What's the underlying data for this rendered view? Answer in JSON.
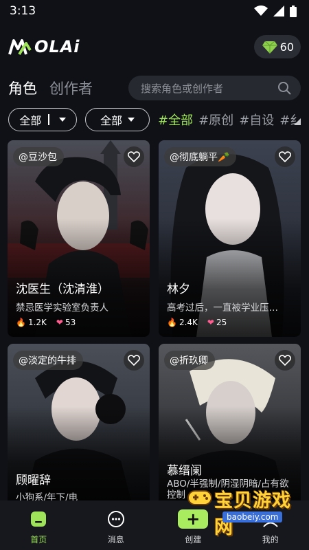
{
  "status_bar": {
    "time": "3:13"
  },
  "header": {
    "logo_text": "OLAi",
    "gem_count": "60"
  },
  "tabs": [
    {
      "label": "角色"
    },
    {
      "label": "创作者"
    }
  ],
  "search": {
    "placeholder": "搜索角色或创作者"
  },
  "filters": {
    "dropdown_1": "全部",
    "dropdown_2": "全部",
    "tags": [
      "#全部",
      "#原创",
      "#自设",
      "#纟"
    ]
  },
  "cards": [
    {
      "author": "@豆沙包",
      "name": "沈医生（沈清淮）",
      "desc": "禁忌医学实验室负责人",
      "heat": "1.2K",
      "likes": "53"
    },
    {
      "author": "@彻底躺平🥕",
      "name": "林夕",
      "desc": "高考过后，一直被学业压…",
      "heat": "2.4K",
      "likes": "25"
    },
    {
      "author": "@淡定的牛排",
      "name": "顾曜辞",
      "desc": "小狗系/年下/电"
    },
    {
      "author": "@折玖卿",
      "name": "慕缙阑",
      "desc": "ABO/半强制/阴湿阴暗/占有欲控制"
    }
  ],
  "bottom_nav": [
    {
      "label": "首页"
    },
    {
      "label": "消息"
    },
    {
      "label": "创建"
    },
    {
      "label": "我的"
    }
  ],
  "watermark": {
    "text": "宝贝游戏网",
    "url": "baobeiy.com"
  },
  "colors": {
    "accent": "#9ee35a",
    "background": "#0f1116",
    "likes": "#ff5d8f",
    "heat": "#ff8a1e"
  }
}
